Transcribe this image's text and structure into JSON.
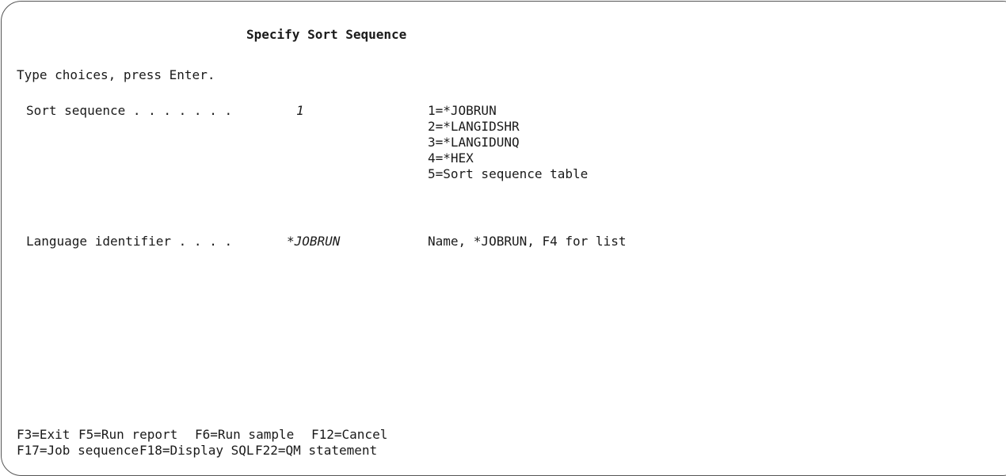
{
  "screen": {
    "title": "Specify Sort Sequence",
    "instruction": "Type choices, press Enter."
  },
  "fields": {
    "sort_sequence": {
      "label": "Sort sequence . . . . . . .",
      "value": "1",
      "options": [
        "1=*JOBRUN",
        "2=*LANGIDSHR",
        "3=*LANGIDUNQ",
        "4=*HEX",
        "5=Sort sequence table"
      ]
    },
    "language_identifier": {
      "label": "Language identifier . . . .",
      "value": "*JOBRUN",
      "hint": "Name, *JOBRUN, F4 for list"
    }
  },
  "function_keys": {
    "row1": [
      "F3=Exit",
      "F5=Run report",
      "F6=Run sample",
      "F12=Cancel"
    ],
    "row2": [
      "F17=Job sequence",
      "F18=Display SQL",
      "F22=QM statement"
    ]
  }
}
